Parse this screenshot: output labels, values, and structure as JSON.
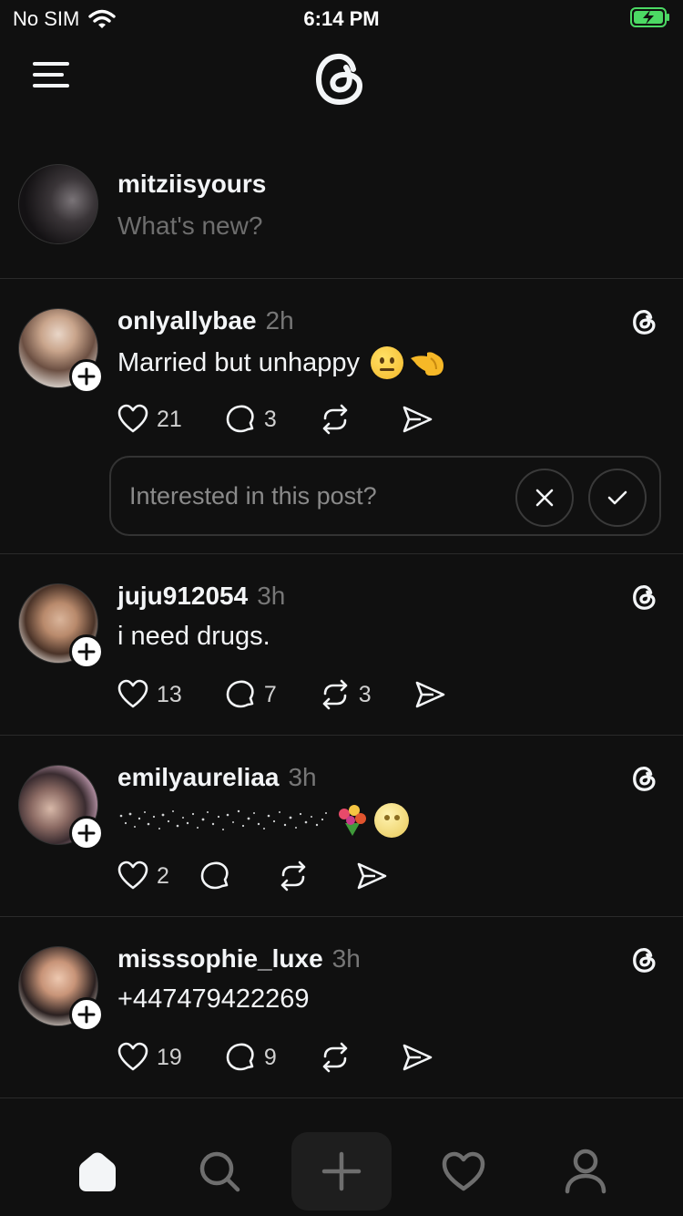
{
  "status_bar": {
    "carrier": "No SIM",
    "time": "6:14 PM"
  },
  "composer": {
    "username": "mitziisyours",
    "placeholder": "What's new?"
  },
  "posts": [
    {
      "username": "onlyallybae",
      "time": "2h",
      "text": "Married but unhappy",
      "likes": "21",
      "replies": "3",
      "reposts": ""
    },
    {
      "username": "juju912054",
      "time": "3h",
      "text": "i need drugs.",
      "likes": "13",
      "replies": "7",
      "reposts": "3"
    },
    {
      "username": "emilyaureliaa",
      "time": "3h",
      "text": "",
      "likes": "2",
      "replies": "",
      "reposts": ""
    },
    {
      "username": "misssophie_luxe",
      "time": "3h",
      "text": "+447479422269",
      "likes": "19",
      "replies": "9",
      "reposts": ""
    }
  ],
  "interest_prompt": {
    "question": "Interested in this post?"
  },
  "icons": [
    "menu-icon",
    "threads-logo-icon",
    "heart-icon",
    "reply-icon",
    "repost-icon",
    "share-icon",
    "close-icon",
    "check-icon",
    "home-icon",
    "search-icon",
    "compose-icon",
    "activity-icon",
    "profile-icon"
  ],
  "colors": {
    "background": "#101010",
    "text": "#f3f5f7",
    "muted": "#777777"
  }
}
